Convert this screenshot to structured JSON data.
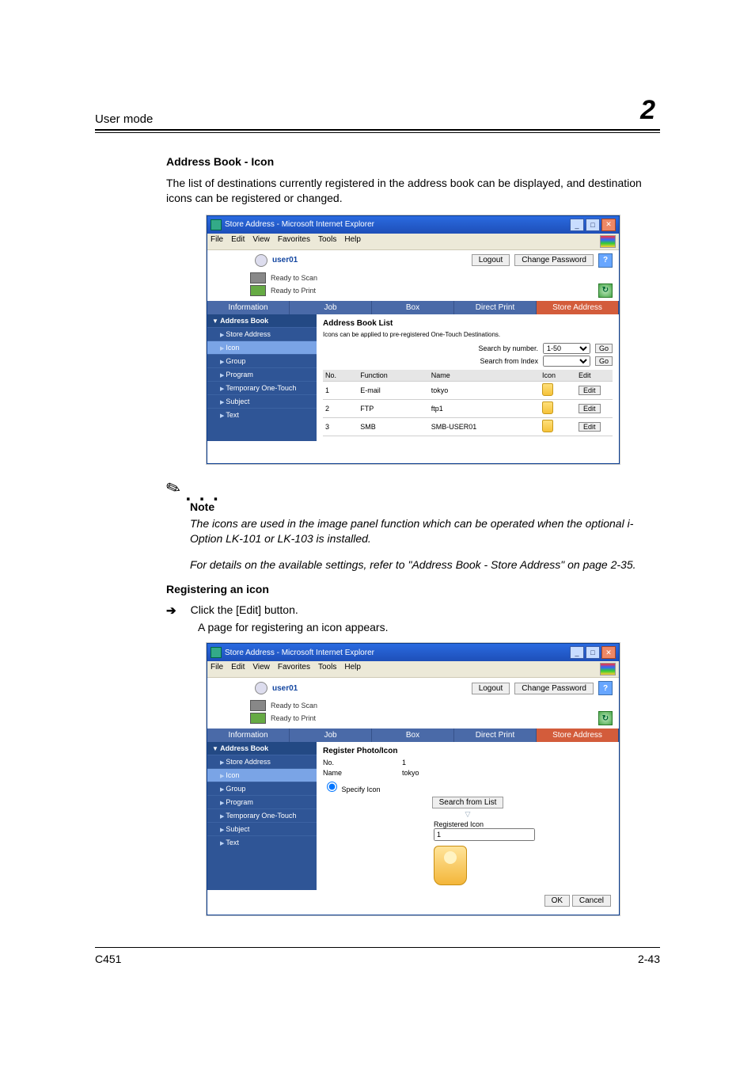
{
  "running_head": {
    "title": "User mode",
    "chapter_number": "2"
  },
  "section1": {
    "heading": "Address Book - Icon",
    "body": "The list of destinations currently registered in the address book can be displayed, and destination icons can be registered or changed."
  },
  "screenshot1": {
    "window_title": "Store Address - Microsoft Internet Explorer",
    "menu": {
      "file": "File",
      "edit": "Edit",
      "view": "View",
      "favorites": "Favorites",
      "tools": "Tools",
      "help": "Help"
    },
    "user": "user01",
    "logout": "Logout",
    "change_password": "Change Password",
    "help": "?",
    "status": {
      "scan": "Ready to Scan",
      "print": "Ready to Print"
    },
    "refresh": "↻",
    "tabs": {
      "information": "Information",
      "job": "Job",
      "box": "Box",
      "direct_print": "Direct Print",
      "store_address": "Store Address"
    },
    "sidebar": {
      "group_head": "Address Book",
      "items": [
        "Store Address",
        "Icon",
        "Group",
        "Program",
        "Temporary One-Touch",
        "Subject",
        "Text"
      ]
    },
    "main": {
      "heading": "Address Book List",
      "desc": "Icons can be applied to pre-registered One-Touch Destinations.",
      "search_number_label": "Search by number.",
      "search_number_value": "1-50",
      "search_index_label": "Search from Index",
      "go": "Go",
      "table": {
        "headers": {
          "no": "No.",
          "function": "Function",
          "name": "Name",
          "icon": "Icon",
          "edit": "Edit"
        },
        "rows": [
          {
            "no": "1",
            "function": "E-mail",
            "name": "tokyo",
            "edit": "Edit"
          },
          {
            "no": "2",
            "function": "FTP",
            "name": "ftp1",
            "edit": "Edit"
          },
          {
            "no": "3",
            "function": "SMB",
            "name": "SMB-USER01",
            "edit": "Edit"
          }
        ]
      }
    }
  },
  "note": {
    "label": "Note",
    "para1": "The icons are used in the image panel function which can be operated when the optional i-Option LK-101 or LK-103 is installed.",
    "para2": "For details on the available settings, refer to \"Address Book - Store Address\" on page 2-35."
  },
  "section2": {
    "heading": "Registering an icon",
    "arrow": "➔",
    "step": "Click the [Edit] button.",
    "sub": "A page for registering an icon appears."
  },
  "screenshot2": {
    "window_title": "Store Address - Microsoft Internet Explorer",
    "menu": {
      "file": "File",
      "edit": "Edit",
      "view": "View",
      "favorites": "Favorites",
      "tools": "Tools",
      "help": "Help"
    },
    "user": "user01",
    "logout": "Logout",
    "change_password": "Change Password",
    "help": "?",
    "status": {
      "scan": "Ready to Scan",
      "print": "Ready to Print"
    },
    "refresh": "↻",
    "tabs": {
      "information": "Information",
      "job": "Job",
      "box": "Box",
      "direct_print": "Direct Print",
      "store_address": "Store Address"
    },
    "sidebar": {
      "group_head": "Address Book",
      "items": [
        "Store Address",
        "Icon",
        "Group",
        "Program",
        "Temporary One-Touch",
        "Subject",
        "Text"
      ]
    },
    "main": {
      "heading": "Register Photo/Icon",
      "no_label": "No.",
      "no_value": "1",
      "name_label": "Name",
      "name_value": "tokyo",
      "specify_label": "Specify Icon",
      "search_from_list": "Search from List",
      "dropdown_marker": "▽",
      "registered_label": "Registered Icon",
      "registered_value": "1",
      "ok": "OK",
      "cancel": "Cancel"
    }
  },
  "footer": {
    "left": "C451",
    "right": "2-43"
  }
}
